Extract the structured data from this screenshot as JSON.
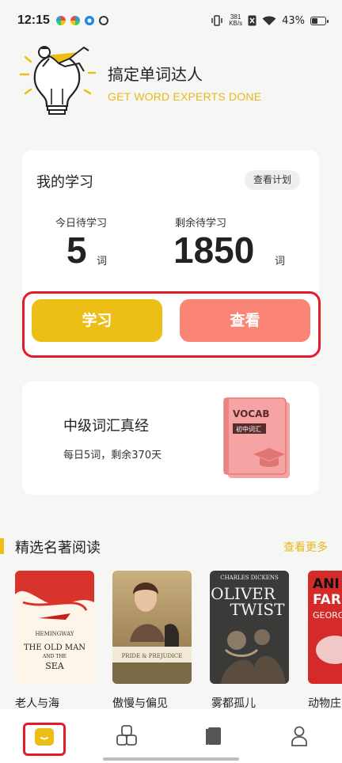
{
  "status_bar": {
    "time": "12:15",
    "net_speed_value": "381",
    "net_speed_unit": "KB/s",
    "battery": "43%"
  },
  "header": {
    "title": "搞定单词达人",
    "subtitle": "GET WORD EXPERTS DONE"
  },
  "study": {
    "title": "我的学习",
    "plan_button": "查看计划",
    "today_label": "今日待学习",
    "today_count": "5",
    "today_unit": "词",
    "remaining_label": "剩余待学习",
    "remaining_count": "1850",
    "remaining_unit": "词",
    "study_button": "学习",
    "view_button": "查看"
  },
  "current_book": {
    "title": "中级词汇真经",
    "subtitle": "每日5词，剩余370天",
    "cover_word": "VOCAB",
    "cover_tag": "初中词汇"
  },
  "featured": {
    "title": "精选名著阅读",
    "more": "查看更多",
    "books": [
      {
        "label": "老人与海",
        "cover": [
          "HEMINGWAY",
          "THE OLD MAN",
          "AND THE",
          "SEA"
        ]
      },
      {
        "label": "傲慢与偏见",
        "cover": [
          "PRIDE & PREJUDICE"
        ]
      },
      {
        "label": "雾都孤儿",
        "cover": [
          "CHARLES DICKENS",
          "OLIVER",
          "TWIST"
        ]
      },
      {
        "label": "动物庄",
        "cover": [
          "ANI",
          "FAR",
          "GEORGE"
        ]
      }
    ]
  },
  "nav": {
    "items": [
      "home-icon",
      "apps-icon",
      "book-icon",
      "profile-icon"
    ]
  },
  "colors": {
    "accent_yellow": "#edbf16",
    "accent_coral": "#fa8476",
    "highlight_red": "#e41b2b"
  }
}
